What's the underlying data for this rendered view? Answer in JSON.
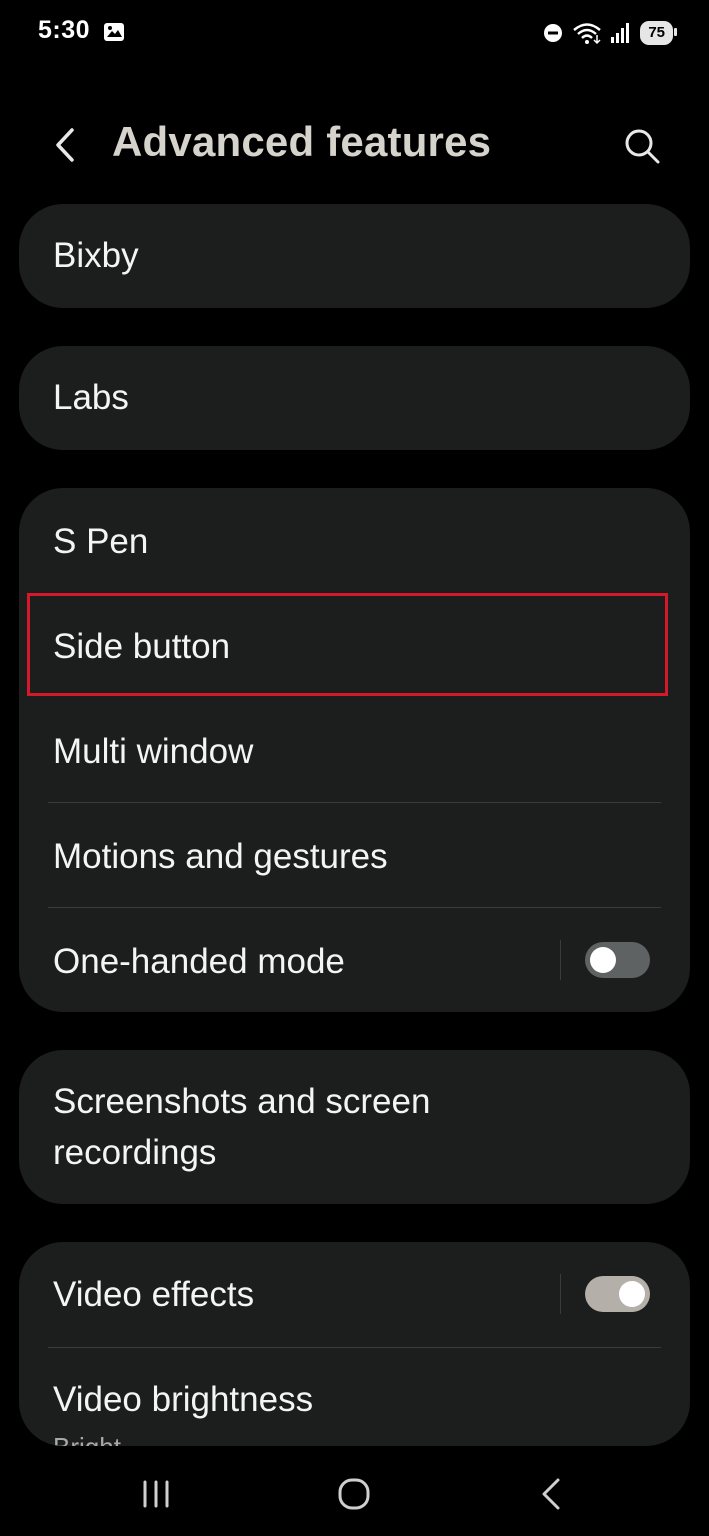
{
  "status_bar": {
    "time": "5:30",
    "battery": "75",
    "icons": [
      "gallery-icon",
      "do-not-disturb-icon",
      "wifi-icon",
      "signal-icon",
      "battery-icon"
    ]
  },
  "header": {
    "title": "Advanced features",
    "back_icon": "chevron-left-icon",
    "search_icon": "search-icon"
  },
  "cards": [
    {
      "items": [
        {
          "label": "Bixby"
        }
      ]
    },
    {
      "items": [
        {
          "label": "Labs"
        }
      ]
    },
    {
      "items": [
        {
          "label": "S Pen"
        },
        {
          "label": "Side button",
          "highlighted": true
        },
        {
          "label": "Multi window"
        },
        {
          "label": "Motions and gestures"
        },
        {
          "label": "One-handed mode",
          "toggle": "off"
        }
      ]
    },
    {
      "items": [
        {
          "label_line1": "Screenshots and screen",
          "label_line2": "recordings"
        }
      ]
    },
    {
      "items": [
        {
          "label": "Video effects",
          "toggle": "on"
        },
        {
          "label": "Video brightness",
          "subtitle": "Bright"
        }
      ]
    }
  ],
  "colors": {
    "background": "#000000",
    "card": "#1c1e1e",
    "title": "#d6d2cc",
    "highlight": "#d6192a",
    "toggle_on": "#b4b0a9",
    "toggle_off": "#5f6262"
  },
  "nav_bar": {
    "recent_icon": "recent-apps-icon",
    "home_icon": "home-icon",
    "back_icon": "back-icon"
  }
}
